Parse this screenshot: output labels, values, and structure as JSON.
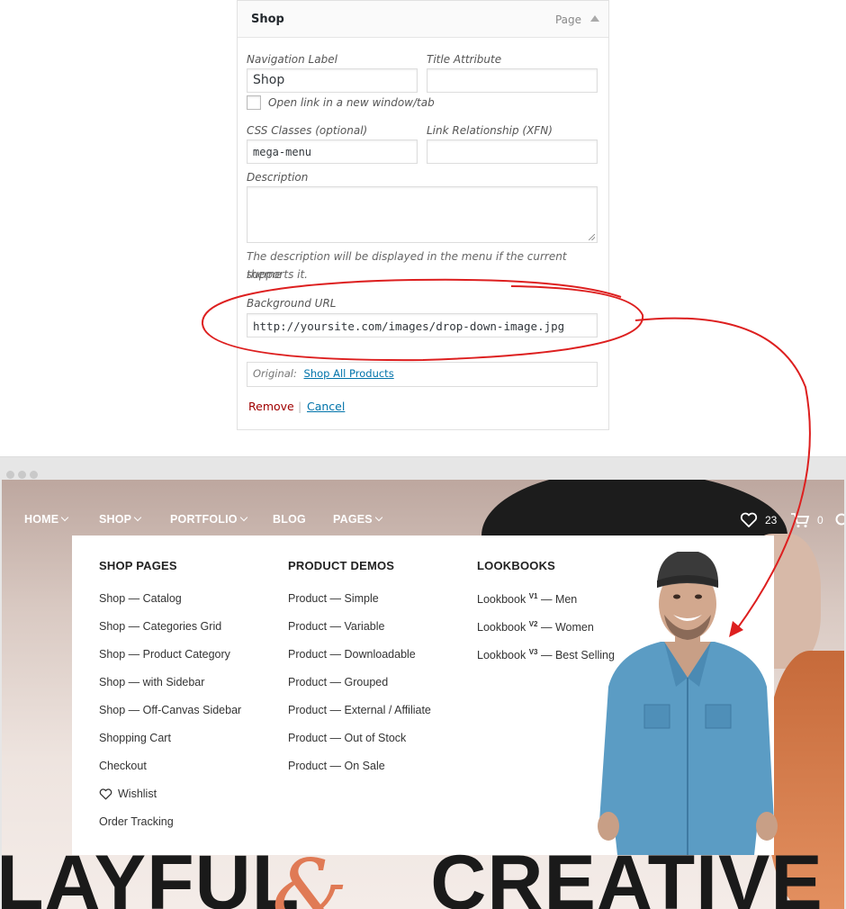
{
  "menu_item": {
    "title": "Shop",
    "type": "Page",
    "nav_label_label": "Navigation Label",
    "nav_label_value": "Shop",
    "title_attr_label": "Title Attribute",
    "title_attr_value": "",
    "new_window_label": "Open link in a new window/tab",
    "css_label": "CSS Classes (optional)",
    "css_value": "mega-menu",
    "xfn_label": "Link Relationship (XFN)",
    "xfn_value": "",
    "description_label": "Description",
    "description_value": "",
    "description_help_1": "The description will be displayed in the menu if the current theme",
    "description_help_2": "supports it.",
    "bg_label": "Background URL",
    "bg_value": "http://yoursite.com/images/drop-down-image.jpg",
    "original_label": "Original:",
    "original_link": "Shop All Products",
    "remove": "Remove",
    "separator": "|",
    "cancel": "Cancel"
  },
  "site": {
    "nav": {
      "home": "HOME",
      "shop": "SHOP",
      "portfolio": "PORTFOLIO",
      "blog": "BLOG",
      "pages": "PAGES",
      "wishlist_count": "23",
      "cart_count": "0"
    },
    "mega": {
      "col1_title": "SHOP PAGES",
      "col1_items": [
        "Shop — Catalog",
        "Shop — Categories Grid",
        "Shop — Product Category",
        "Shop — with Sidebar",
        "Shop — Off-Canvas Sidebar",
        "Shopping Cart",
        "Checkout",
        "Wishlist",
        "Order Tracking"
      ],
      "col2_title": "PRODUCT DEMOS",
      "col2_items": [
        "Product — Simple",
        "Product — Variable",
        "Product — Downloadable",
        "Product — Grouped",
        "Product — External / Affiliate",
        "Product — Out of Stock",
        "Product — On Sale"
      ],
      "col3_title": "LOOKBOOKS",
      "col3_items": [
        {
          "base": "Lookbook",
          "ver": "V1",
          "rest": " — Men"
        },
        {
          "base": "Lookbook",
          "ver": "V2",
          "rest": " — Women"
        },
        {
          "base": "Lookbook",
          "ver": "V3",
          "rest": " — Best Selling"
        }
      ]
    },
    "hero_text_left": "LAYFUL",
    "hero_amp": "&",
    "hero_text_right": "CREATIVE"
  },
  "colors": {
    "annotation": "#dd1f1f",
    "wp_link": "#0073aa",
    "remove_link": "#a00000",
    "hero_amp": "#e07a55"
  },
  "icons": {
    "heart": "heart-icon",
    "cart": "cart-icon",
    "search": "search-icon",
    "collapse": "triangle-up-icon"
  }
}
